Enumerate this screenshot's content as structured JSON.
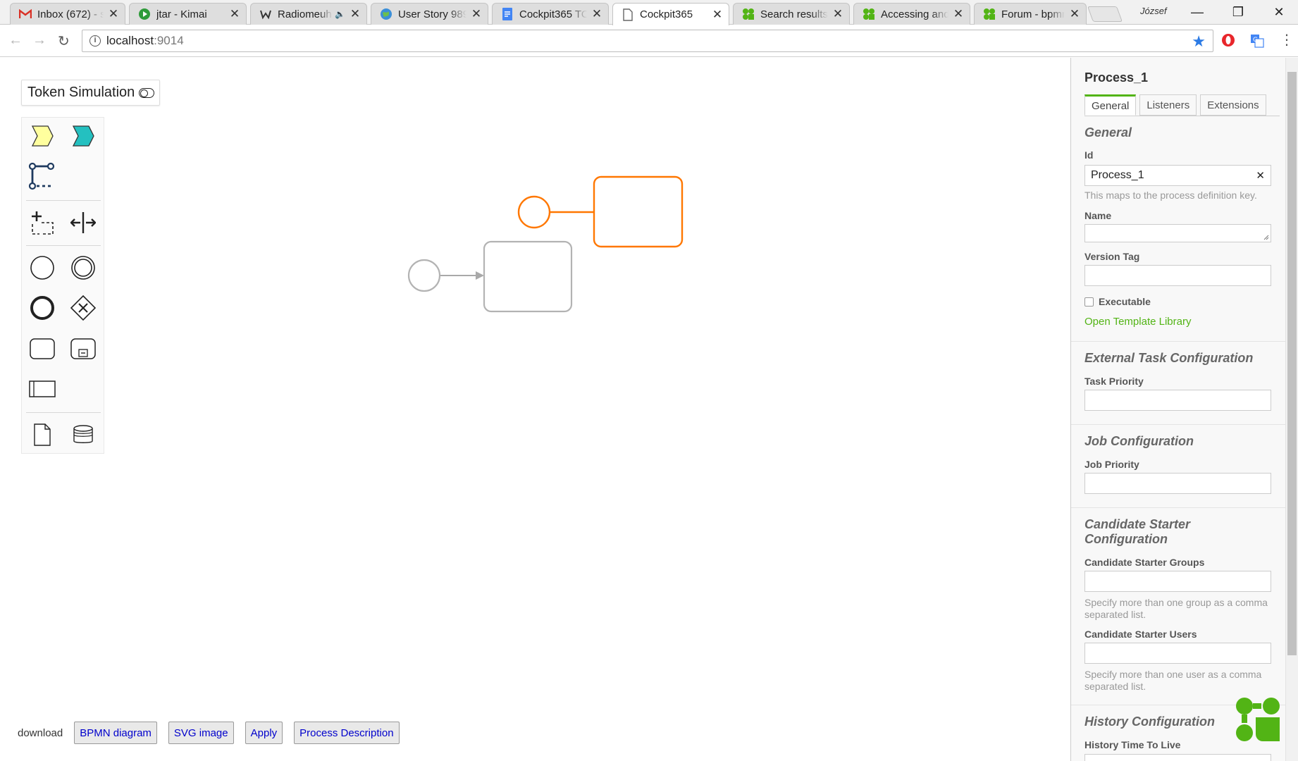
{
  "browser": {
    "tabs": [
      {
        "title": "Inbox (672) - s",
        "icon": "gmail-icon"
      },
      {
        "title": "jtar - Kimai",
        "icon": "kimai-icon"
      },
      {
        "title": "Radiomeuh",
        "icon": "radio-icon",
        "muted": true
      },
      {
        "title": "User Story 989",
        "icon": "globe-icon"
      },
      {
        "title": "Cockpit365 TO",
        "icon": "docs-icon"
      },
      {
        "title": "Cockpit365",
        "icon": "page-icon",
        "active": true
      },
      {
        "title": "Search results",
        "icon": "camunda-icon"
      },
      {
        "title": "Accessing and",
        "icon": "camunda-icon"
      },
      {
        "title": "Forum - bpmn",
        "icon": "camunda-icon"
      }
    ],
    "profile_name": "József",
    "url_host": "localhost",
    "url_port": ":9014"
  },
  "canvas": {
    "token_simulation_label": "Token Simulation",
    "palette_tools": [
      "hand-tool",
      "lasso-tool",
      "space-tool",
      "global-connect-tool",
      "create-start-event",
      "create-intermediate-event",
      "create-end-event",
      "create-gateway",
      "create-task",
      "create-subprocess",
      "create-pool",
      "create-data-object",
      "create-data-store"
    ]
  },
  "panel": {
    "title": "Process_1",
    "tabs": [
      "General",
      "Listeners",
      "Extensions"
    ],
    "general_heading": "General",
    "id_label": "Id",
    "id_value": "Process_1",
    "id_desc": "This maps to the process definition key.",
    "name_label": "Name",
    "version_label": "Version Tag",
    "executable_label": "Executable",
    "template_link": "Open Template Library",
    "external_heading": "External Task Configuration",
    "task_priority_label": "Task Priority",
    "job_heading": "Job Configuration",
    "job_priority_label": "Job Priority",
    "candidate_heading": "Candidate Starter Configuration",
    "candidate_groups_label": "Candidate Starter Groups",
    "candidate_groups_desc": "Specify more than one group as a comma separated list.",
    "candidate_users_label": "Candidate Starter Users",
    "candidate_users_desc": "Specify more than one user as a comma separated list.",
    "history_heading": "History Configuration",
    "history_ttl_label": "History Time To Live"
  },
  "bottom": {
    "download_label": "download",
    "buttons": [
      "BPMN diagram",
      "SVG image",
      "Apply",
      "Process Description"
    ]
  },
  "colors": {
    "accent_green": "#52b415",
    "selected_orange": "#ff7700",
    "link_blue": "#0000cc"
  }
}
